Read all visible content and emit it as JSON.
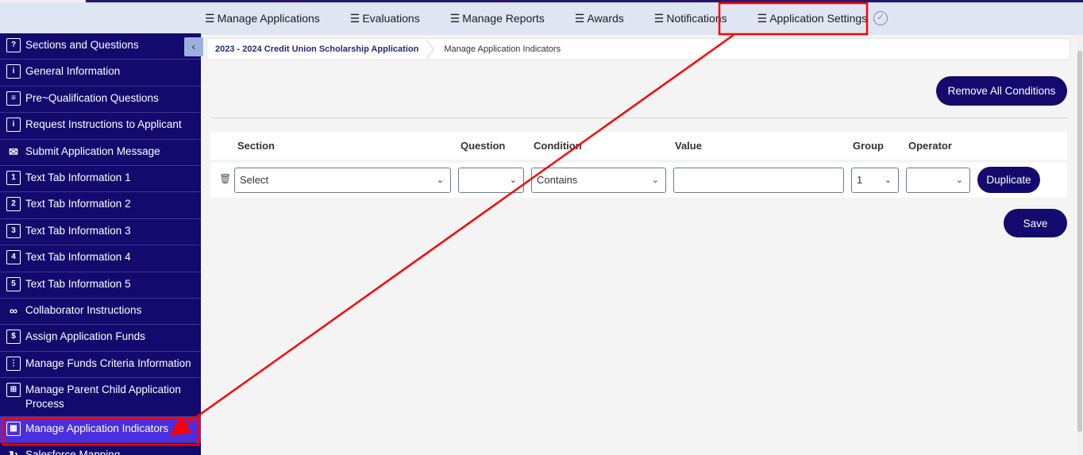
{
  "top_nav": {
    "items": [
      {
        "label": "Manage Applications"
      },
      {
        "label": "Evaluations"
      },
      {
        "label": "Manage Reports"
      },
      {
        "label": "Awards"
      },
      {
        "label": "Notifications"
      },
      {
        "label": "Application Settings"
      }
    ]
  },
  "sidebar": {
    "items": [
      {
        "label": "Sections and Questions",
        "icon": "?≡"
      },
      {
        "label": "General Information",
        "icon": "i"
      },
      {
        "label": "Pre~Qualification Questions",
        "icon": "☰"
      },
      {
        "label": "Request Instructions to Applicant",
        "icon": "i≡"
      },
      {
        "label": "Submit Application Message",
        "icon": "✉"
      },
      {
        "label": "Text Tab Information 1",
        "icon": "1"
      },
      {
        "label": "Text Tab Information 2",
        "icon": "2"
      },
      {
        "label": "Text Tab Information 3",
        "icon": "3"
      },
      {
        "label": "Text Tab Information 4",
        "icon": "4"
      },
      {
        "label": "Text Tab Information 5",
        "icon": "5"
      },
      {
        "label": "Collaborator Instructions",
        "icon": "🤝"
      },
      {
        "label": "Assign Application Funds",
        "icon": "$"
      },
      {
        "label": "Manage Funds Criteria Information",
        "icon": "⋮"
      },
      {
        "label": "Manage Parent Child Application Process",
        "icon": "⊞"
      },
      {
        "label": "Manage Application Indicators",
        "icon": "▦"
      },
      {
        "label": "Salesforce Mapping",
        "icon": "↻"
      }
    ]
  },
  "breadcrumb": {
    "link": "2023 - 2024 Credit Union Scholarship Application",
    "current": "Manage Application Indicators"
  },
  "actions": {
    "remove_all": "Remove All Conditions",
    "duplicate": "Duplicate",
    "save": "Save"
  },
  "grid": {
    "headers": {
      "section": "Section",
      "question": "Question",
      "condition": "Condition",
      "value": "Value",
      "group": "Group",
      "operator": "Operator"
    },
    "row": {
      "section": "Select",
      "question": "",
      "condition": "Contains",
      "value": "",
      "group": "1",
      "operator": ""
    }
  },
  "colors": {
    "primary": "#140a6e",
    "active_sidebar": "#4a2fe0",
    "annotation": "#ff0000"
  }
}
